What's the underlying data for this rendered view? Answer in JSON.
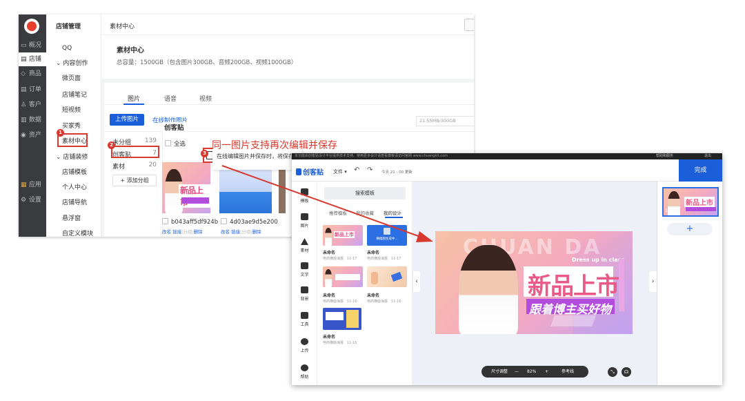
{
  "admin": {
    "left_nav": [
      {
        "label": "概况",
        "icon": "monitor-icon"
      },
      {
        "label": "店铺",
        "icon": "store-icon",
        "active": true
      },
      {
        "label": "商品",
        "icon": "tag-icon"
      },
      {
        "label": "订单",
        "icon": "list-icon"
      },
      {
        "label": "客户",
        "icon": "user-icon"
      },
      {
        "label": "数据",
        "icon": "chart-icon"
      },
      {
        "label": "资产",
        "icon": "coin-icon"
      },
      {
        "label": "应用",
        "icon": "apps-icon"
      },
      {
        "label": "设置",
        "icon": "gear-icon"
      }
    ],
    "sub_nav_title": "店铺管理",
    "sub_nav": {
      "qq": "QQ",
      "group_content": "内容创作",
      "items_content": [
        "微页面",
        "店铺笔记",
        "短视频",
        "买家秀",
        "素材中心"
      ],
      "group_decor": "店铺装修",
      "items_decor": [
        "店铺模板",
        "个人中心",
        "店铺导航",
        "悬浮窗",
        "自定义模块"
      ]
    },
    "breadcrumb": "素材中心",
    "page_title": "素材中心",
    "capacity_text": "总容量：1500GB（包含图片300GB、音频200GB、视频1000GB）",
    "tabs": [
      "图片",
      "语音",
      "视频"
    ],
    "upload_button": "上传图片",
    "online_make_link": "在线制作图片",
    "storage_usage": "21.55MB/300GB",
    "groups": [
      {
        "name": "未分组",
        "count": "139"
      },
      {
        "name": "创客贴",
        "count": "7"
      },
      {
        "name": "素材",
        "count": "20"
      }
    ],
    "add_group_button": "+ 添加分组",
    "current_group_title": "创客贴",
    "select_all": "全选",
    "edit_tooltip": "在线编辑图片并保存时，将保存为",
    "images": [
      {
        "name": "b043aff5df924b",
        "actions": [
          "改名",
          "链接",
          "分组",
          "删除"
        ]
      },
      {
        "name": "4d03ae9d5e200",
        "actions": [
          "改名",
          "链接",
          "分组",
          "删除"
        ]
      }
    ],
    "action_sep": "|"
  },
  "annotations": {
    "badge_1": "1",
    "badge_2": "2",
    "badge_3": "3",
    "caption": "同一图片支持再次编辑并保存",
    "color": "#d8392f"
  },
  "editor": {
    "top_notice": "本功能由创客贴设计平台提供技术支持。使用更多设计请查看模板请访问官网 www.chuangkit.com",
    "top_right_help": "帮助和服务",
    "top_right_exit": "退出",
    "brand": "创客贴",
    "file_menu": "文件 ▾",
    "save_status": "今天 21 : 00 更新",
    "done_button": "完成",
    "tools": [
      "模板",
      "图片",
      "素材",
      "文字",
      "背景",
      "工具",
      "上传",
      "帮助"
    ],
    "search_button": "搜索模板",
    "panel_tabs": [
      "推荐模板",
      "我的收藏",
      "我的设计"
    ],
    "designs": [
      {
        "name": "未命名",
        "meta": "电商横版海报",
        "date": "11-17"
      },
      {
        "name": "未命名",
        "meta": "电商横版海报",
        "date": "11-17",
        "thumb_text": "横幅图生成中..."
      },
      {
        "name": "未命名",
        "meta": "电商横版海报",
        "date": "11-16"
      },
      {
        "name": "未命名",
        "meta": "电商横版海报",
        "date": "11-16"
      },
      {
        "name": "未命名",
        "meta": "电商横版海报",
        "date": "11-16"
      }
    ],
    "poster": {
      "bg_text": "CHUAN DA",
      "headline": "新品上市",
      "tagline": "跟着博主买好物",
      "subtitle": "Dress up in class"
    },
    "thumb_headline": "新品上市",
    "zoom_label": "尺寸调整",
    "zoom_value": "82%",
    "zoom_minus": "—",
    "zoom_plus": "+",
    "guides_label": "参考线",
    "page_number": "1",
    "add_page": "+",
    "prev_arrow": "‹",
    "next_arrow": "›"
  }
}
